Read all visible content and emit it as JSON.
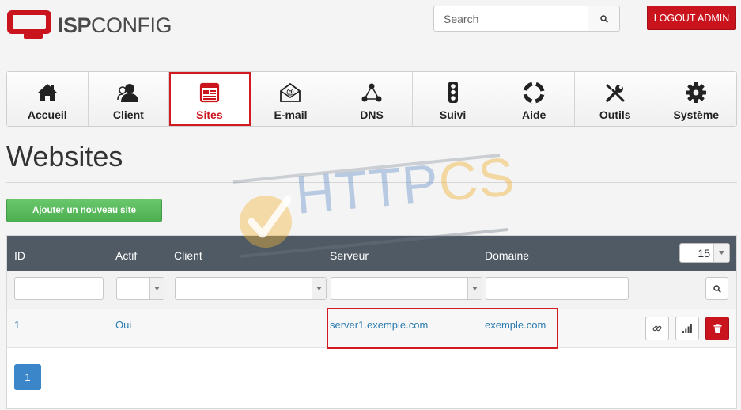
{
  "header": {
    "logo": {
      "bold": "ISP",
      "light": "CONFIG"
    },
    "search": {
      "placeholder": "Search"
    },
    "logout_label": "LOGOUT ADMIN"
  },
  "nav": {
    "tabs": [
      {
        "label": "Accueil",
        "icon": "home-icon"
      },
      {
        "label": "Client",
        "icon": "user-icon"
      },
      {
        "label": "Sites",
        "icon": "sites-icon",
        "active": true
      },
      {
        "label": "E-mail",
        "icon": "email-icon"
      },
      {
        "label": "DNS",
        "icon": "dns-icon"
      },
      {
        "label": "Suivi",
        "icon": "traffic-light-icon"
      },
      {
        "label": "Aide",
        "icon": "lifebuoy-icon"
      },
      {
        "label": "Outils",
        "icon": "tools-icon"
      },
      {
        "label": "Système",
        "icon": "gear-icon"
      }
    ]
  },
  "main": {
    "title": "Websites",
    "add_button": "Ajouter un nouveau site",
    "table": {
      "columns": [
        "ID",
        "Actif",
        "Client",
        "Serveur",
        "Domaine"
      ],
      "per_page": "15",
      "rows": [
        {
          "id": "1",
          "actif": "Oui",
          "client": "",
          "serveur": "server1.exemple.com",
          "domaine": "exemple.com"
        }
      ]
    },
    "pagination": {
      "current": "1"
    }
  },
  "watermark": {
    "text_a": "HTTP",
    "text_b": "CS"
  },
  "colors": {
    "accent_red": "#c9141d",
    "header_dark": "#4f5a64",
    "link_blue": "#2a7bb0",
    "add_green": "#4caf50",
    "page_blue": "#3a86c8"
  }
}
